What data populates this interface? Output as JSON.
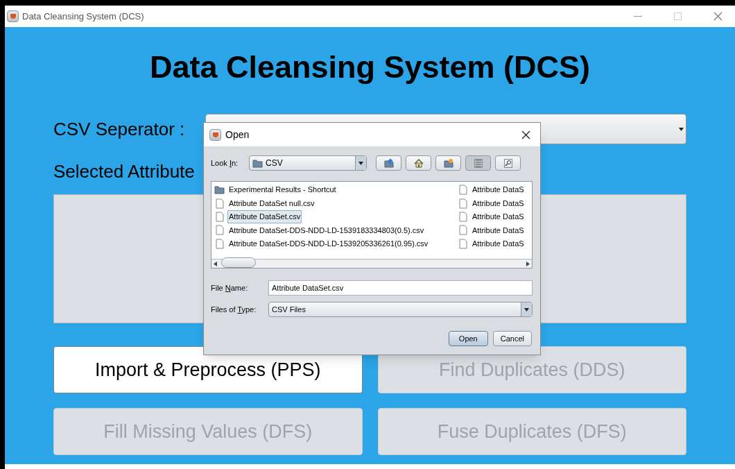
{
  "window": {
    "title": "Data Cleansing System (DCS)"
  },
  "heading": "Data Cleansing System (DCS)",
  "csv_separator": {
    "label": "CSV Seperator :"
  },
  "selected_attributes": {
    "label": "Selected Attribute"
  },
  "buttons": [
    {
      "label": "Import & Preprocess (PPS)",
      "disabled": false
    },
    {
      "label": "Find Duplicates (DDS)",
      "disabled": true
    },
    {
      "label": "Fill Missing Values (DFS)",
      "disabled": true
    },
    {
      "label": "Fuse Duplicates (DFS)",
      "disabled": true
    }
  ],
  "dialog": {
    "title": "Open",
    "look_in": {
      "label_parts": [
        "Look ",
        "I",
        "n:"
      ],
      "value": "CSV"
    },
    "toolbar": [
      {
        "kind": "up",
        "selected": false
      },
      {
        "kind": "home",
        "selected": false
      },
      {
        "kind": "newfolder",
        "selected": false
      },
      {
        "kind": "list",
        "selected": true
      },
      {
        "kind": "details",
        "selected": false
      }
    ],
    "files": [
      {
        "kind": "folder",
        "name": "Experimental Results - Shortcut",
        "selected": false
      },
      {
        "kind": "file",
        "name": "Attribute DataSet null.csv",
        "selected": false
      },
      {
        "kind": "file",
        "name": "Attribute DataSet.csv",
        "selected": true
      },
      {
        "kind": "file",
        "name": "Attribute DataSet-DDS-NDD-LD-1539183334803(0.5).csv",
        "selected": false
      },
      {
        "kind": "file",
        "name": "Attribute DataSet-DDS-NDD-LD-1539205336261(0.95).csv",
        "selected": false
      }
    ],
    "files_column_2": [
      {
        "kind": "file",
        "name": "Attribute DataS",
        "selected": false
      },
      {
        "kind": "file",
        "name": "Attribute DataS",
        "selected": false
      },
      {
        "kind": "file",
        "name": "Attribute DataS",
        "selected": false
      },
      {
        "kind": "file",
        "name": "Attribute DataS",
        "selected": false
      },
      {
        "kind": "file",
        "name": "Attribute DataS",
        "selected": false
      }
    ],
    "file_name": {
      "label_parts": [
        "File ",
        "N",
        "ame:"
      ],
      "value": "Attribute DataSet.csv"
    },
    "files_of_type": {
      "label_parts": [
        "Files of ",
        "T",
        "ype:"
      ],
      "value": "CSV Files"
    },
    "actions": [
      "Open",
      "Cancel"
    ]
  }
}
